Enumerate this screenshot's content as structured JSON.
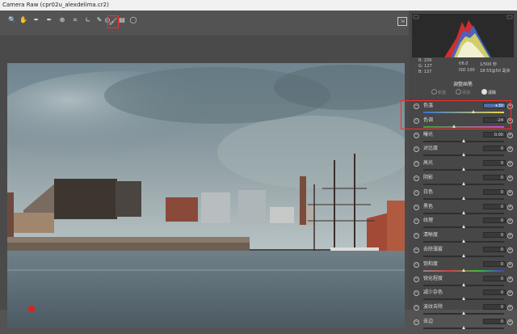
{
  "window": {
    "title": "Camera Raw (cpr02u_alexdelima.cr2)"
  },
  "toolbar": {
    "tools": [
      {
        "icon": "zoom-icon",
        "glyph": "🔍"
      },
      {
        "icon": "hand-icon",
        "glyph": "✋"
      },
      {
        "icon": "white-balance-icon",
        "glyph": "✒"
      },
      {
        "icon": "color-sampler-icon",
        "glyph": "✒"
      },
      {
        "icon": "target-adjust-icon",
        "glyph": "⊕"
      },
      {
        "icon": "crop-icon",
        "glyph": "⌗"
      },
      {
        "icon": "straighten-icon",
        "glyph": "∟"
      },
      {
        "icon": "spot-removal-icon",
        "glyph": "✎"
      },
      {
        "icon": "red-eye-icon",
        "glyph": "◎"
      },
      {
        "icon": "adjustment-brush-icon",
        "glyph": "🖌"
      },
      {
        "icon": "graduated-filter-icon",
        "glyph": "▤"
      },
      {
        "icon": "radial-filter-icon",
        "glyph": "◯"
      }
    ],
    "active_tool": "adjustment-brush-icon",
    "right_icon": "open-preferences-icon"
  },
  "readout": {
    "r": "R:  109",
    "g": "G:  127",
    "b": "B:  137",
    "aperture": "f/6.0",
    "shutter": "1/500 秒",
    "iso": "ISO 100",
    "lens": "18-55@50 毫米"
  },
  "panel": {
    "section_title": "调整画笔",
    "modes": [
      {
        "label": "新建",
        "selected": false
      },
      {
        "label": "添加",
        "selected": false
      },
      {
        "label": "清除",
        "selected": true
      }
    ],
    "sliders": [
      {
        "label": "色温",
        "value": "+30",
        "selected": true,
        "pos": 0.62,
        "track": "temp"
      },
      {
        "label": "色调",
        "value": "-24",
        "selected": false,
        "pos": 0.38,
        "track": "tint"
      },
      {
        "label": "曝光",
        "value": "0.00",
        "selected": false,
        "pos": 0.5,
        "track": "plain"
      },
      {
        "label": "对比度",
        "value": "0",
        "selected": false,
        "pos": 0.5,
        "track": "plain"
      },
      {
        "label": "高光",
        "value": "0",
        "selected": false,
        "pos": 0.5,
        "track": "plain"
      },
      {
        "label": "阴影",
        "value": "0",
        "selected": false,
        "pos": 0.5,
        "track": "plain"
      },
      {
        "label": "白色",
        "value": "0",
        "selected": false,
        "pos": 0.5,
        "track": "plain"
      },
      {
        "label": "黑色",
        "value": "0",
        "selected": false,
        "pos": 0.5,
        "track": "plain"
      },
      {
        "label": "纹理",
        "value": "0",
        "selected": false,
        "pos": 0.5,
        "track": "plain"
      },
      {
        "label": "清晰度",
        "value": "0",
        "selected": false,
        "pos": 0.5,
        "track": "plain"
      },
      {
        "label": "去除薄雾",
        "value": "0",
        "selected": false,
        "pos": 0.5,
        "track": "plain"
      },
      {
        "label": "饱和度",
        "value": "0",
        "selected": false,
        "pos": 0.5,
        "track": "sat"
      },
      {
        "label": "锐化程度",
        "value": "0",
        "selected": false,
        "pos": 0.5,
        "track": "plain"
      },
      {
        "label": "减少杂色",
        "value": "0",
        "selected": false,
        "pos": 0.5,
        "track": "plain"
      },
      {
        "label": "波纹去除",
        "value": "0",
        "selected": false,
        "pos": 0.5,
        "track": "plain"
      },
      {
        "label": "去边",
        "value": "0",
        "selected": false,
        "pos": 0.5,
        "track": "plain"
      }
    ]
  },
  "colors": {
    "highlight": "#ff2a2a",
    "selected_value": "#4e6fa8",
    "pin": "#e02020"
  }
}
